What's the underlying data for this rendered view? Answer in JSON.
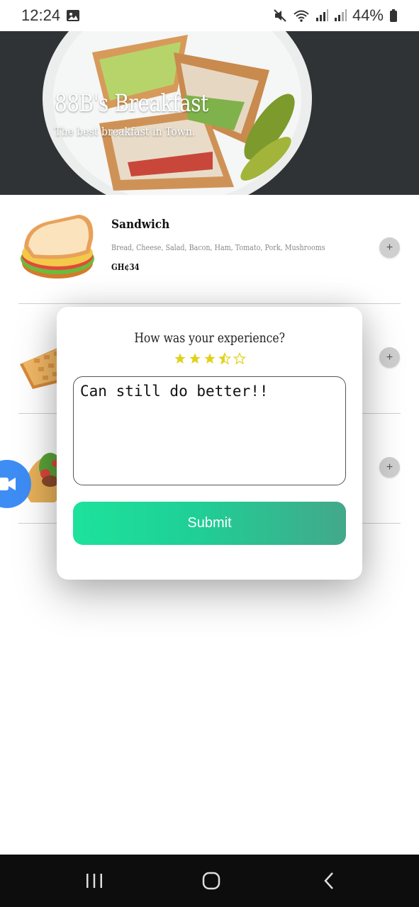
{
  "status_bar": {
    "time": "12:24",
    "battery": "44%",
    "icons": [
      "image-icon",
      "mute-icon",
      "wifi-icon",
      "signal-icon",
      "signal-icon",
      "battery-icon"
    ]
  },
  "hero": {
    "title": "88B's Breakfast",
    "subtitle": "The best breakfast in Town."
  },
  "menu": {
    "items": [
      {
        "name": "Sandwich",
        "description": "Bread, Cheese, Salad, Bacon, Ham, Tomato, Pork, Mushrooms",
        "price": "GH¢34",
        "icon": "sandwich-icon",
        "add_label": "+"
      },
      {
        "icon": "waffle-icon",
        "add_label": "+"
      },
      {
        "icon": "taco-icon",
        "add_label": "+"
      }
    ]
  },
  "float_button": {
    "icon": "video-camera-icon"
  },
  "rating_modal": {
    "question": "How was your experience?",
    "rating": 3.5,
    "max_rating": 5,
    "feedback_value": "Can still do better!!",
    "submit_label": "Submit",
    "star_color": "#e0d21c",
    "button_gradient": [
      "#1de29c",
      "#43a88a"
    ]
  },
  "nav_bar": {
    "buttons": [
      "recent-apps-icon",
      "home-icon",
      "back-icon"
    ]
  }
}
